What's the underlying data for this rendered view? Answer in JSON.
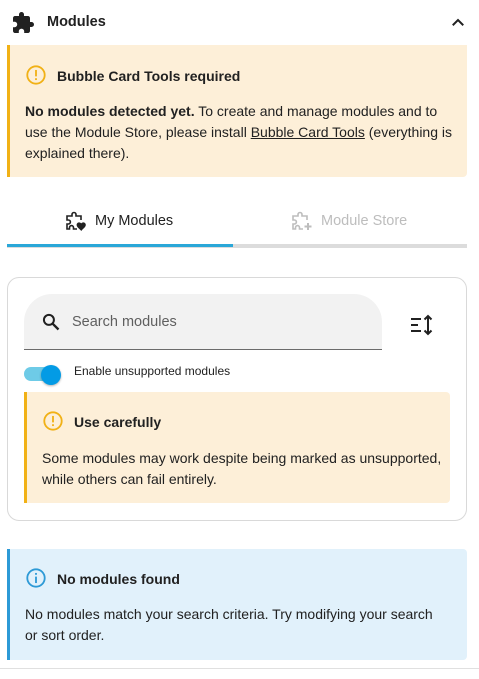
{
  "header": {
    "title": "Modules",
    "icon": "puzzle-icon",
    "collapse_icon": "chevron-up-icon"
  },
  "tools_alert": {
    "title": "Bubble Card Tools required",
    "body_bold": "No modules detected yet.",
    "body_text": " To create and manage modules and to use the Module Store, please install ",
    "link": "Bubble Card Tools",
    "body_end": " (everything is explained there).",
    "icon": "alert-circle-icon"
  },
  "tabs": [
    {
      "label": "My Modules",
      "icon": "puzzle-heart-icon",
      "active": true
    },
    {
      "label": "Module Store",
      "icon": "puzzle-plus-icon",
      "active": false
    }
  ],
  "search": {
    "placeholder": "Search modules",
    "value": ""
  },
  "toggle": {
    "label": "Enable unsupported modules",
    "on": true
  },
  "caution_alert": {
    "title": "Use carefully",
    "body": "Some modules may work despite being marked as unsupported, while others can fail entirely."
  },
  "empty_alert": {
    "title": "No modules found",
    "body": "No modules match your search criteria. Try modifying your search or sort order."
  },
  "colors": {
    "warning": "#f1b116",
    "warning_bg": "#fdefd8",
    "info": "#2d9ad6",
    "info_bg": "#e1f1fb",
    "accent": "#039be5"
  }
}
